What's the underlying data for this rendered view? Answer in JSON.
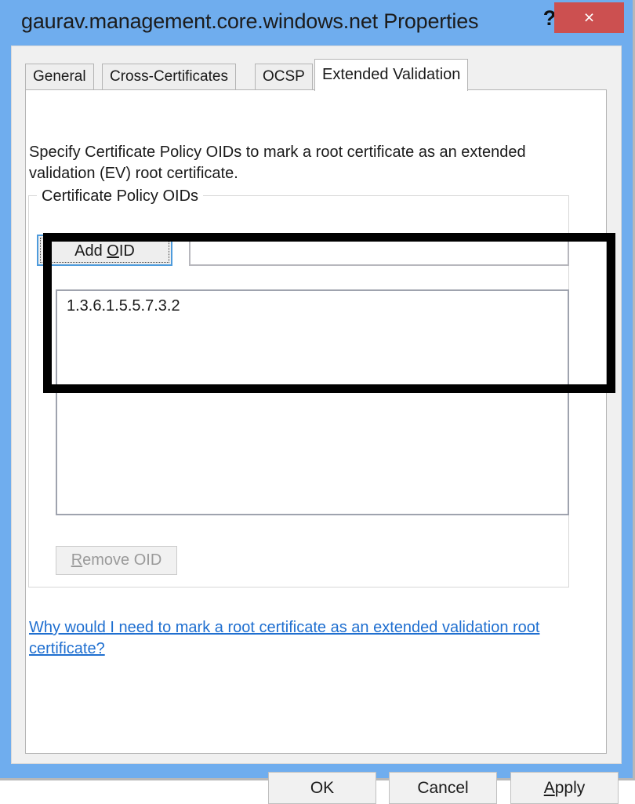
{
  "window": {
    "title": "gaurav.management.core.windows.net Properties",
    "help_icon": "?",
    "close_icon": "×",
    "frame_color": "#6fadee",
    "close_button_color": "#cc5050"
  },
  "tabs": [
    {
      "label": "General",
      "active": false
    },
    {
      "label": "Cross-Certificates",
      "active": false
    },
    {
      "label": "OCSP",
      "active": false
    },
    {
      "label": "Extended Validation",
      "active": true
    }
  ],
  "main": {
    "description": "Specify Certificate Policy OIDs to mark a root certificate as an extended validation (EV) root certificate.",
    "group_box": {
      "title": "Certificate Policy OIDs",
      "add_button": {
        "label_before": "Add ",
        "accel": "O",
        "label_after": "ID"
      },
      "oid_input": {
        "value": "",
        "placeholder": ""
      },
      "list_items": [
        "1.3.6.1.5.5.7.3.2"
      ],
      "remove_button": {
        "accel": "R",
        "label_after": "emove OID",
        "enabled": false
      }
    },
    "help_link": "Why would I need to mark a root certificate as an extended validation root certificate?"
  },
  "footer": {
    "ok_label": "OK",
    "cancel_label": "Cancel",
    "apply": {
      "accel": "A",
      "label_after": "pply"
    }
  },
  "annotation": {
    "type": "highlight-rectangle",
    "color": "#000000"
  }
}
